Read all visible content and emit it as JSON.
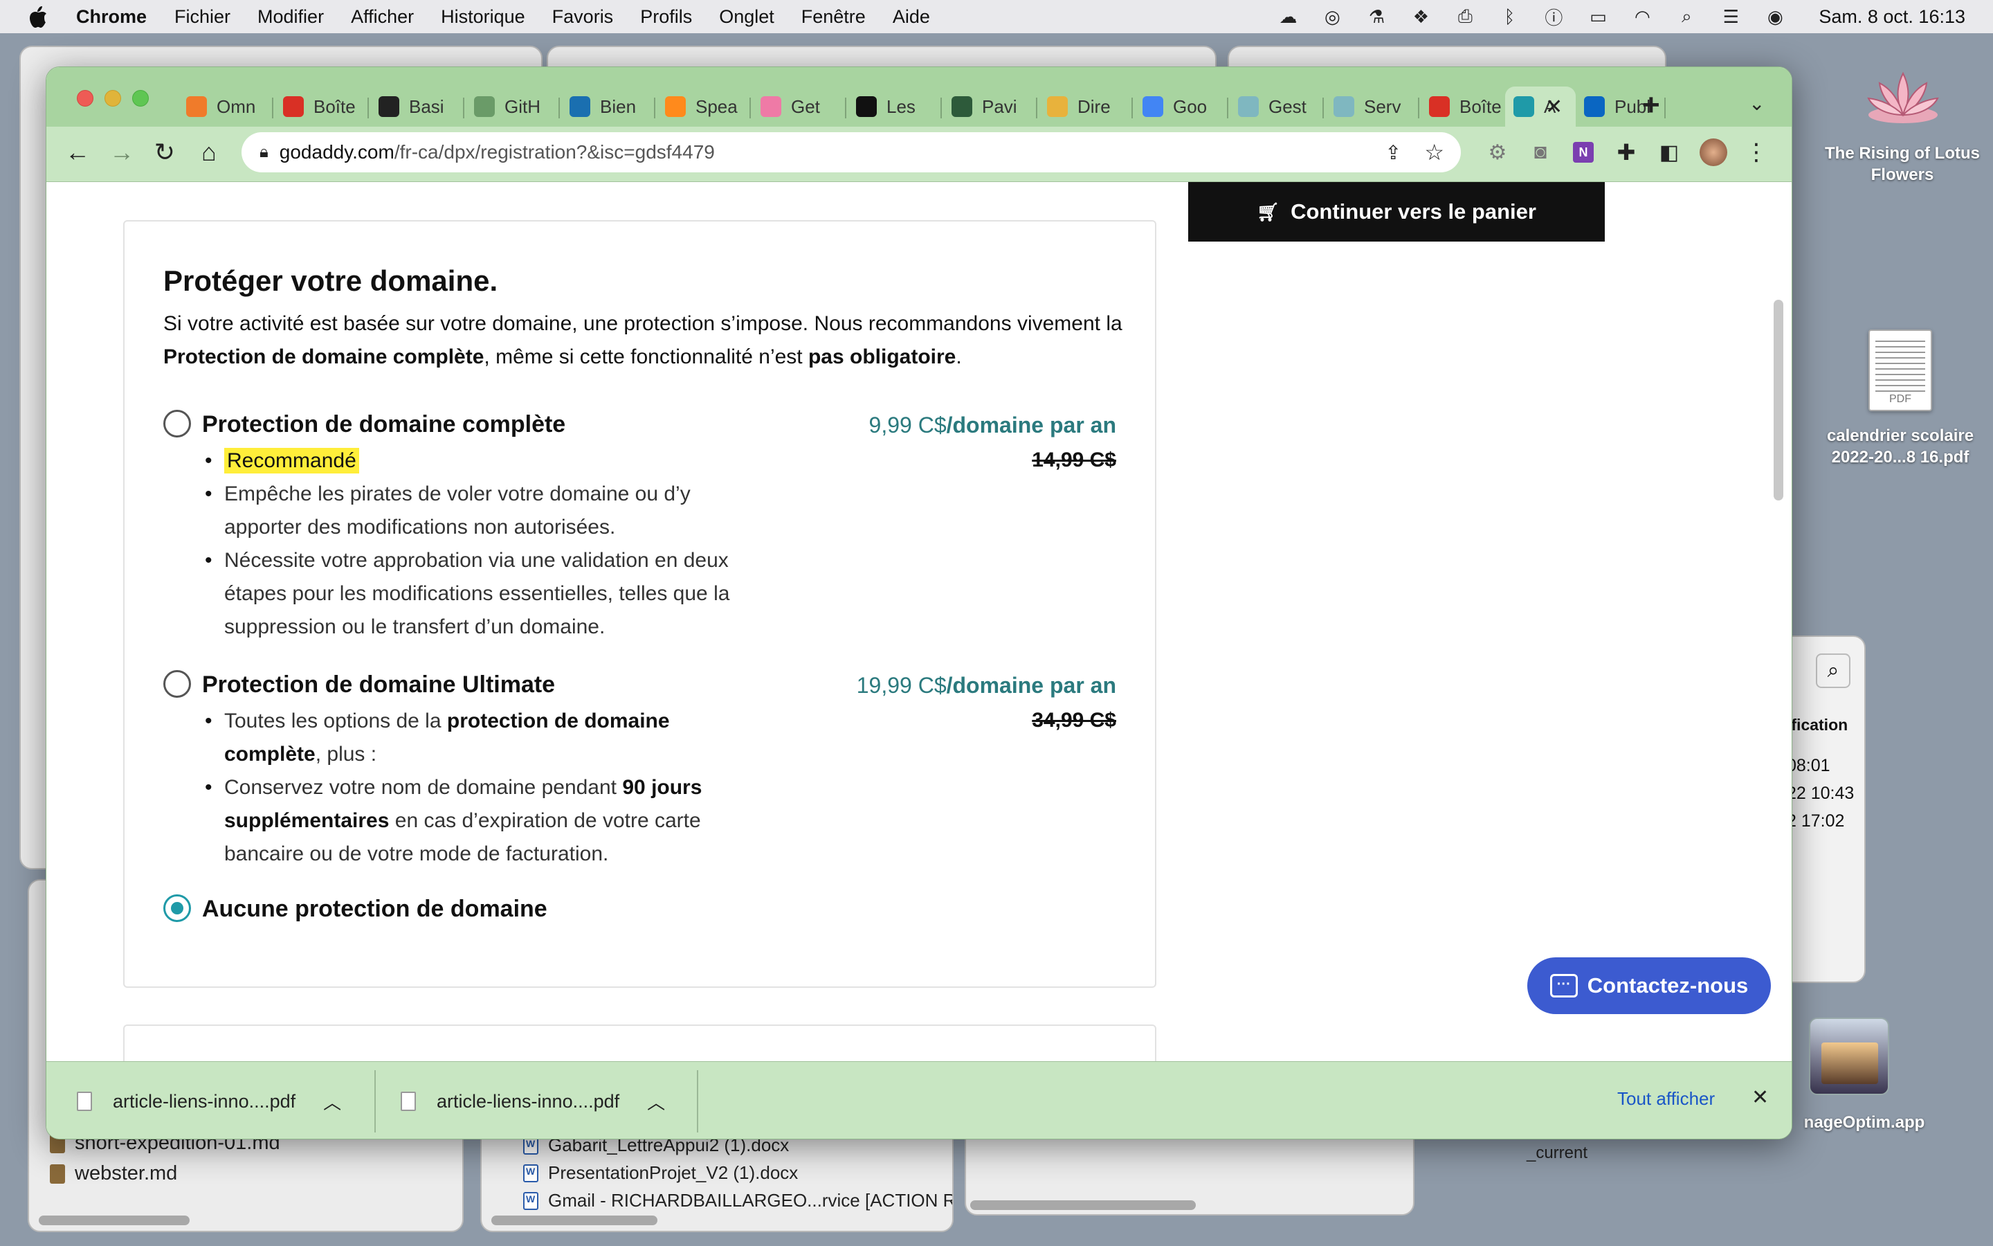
{
  "menubar": {
    "app": "Chrome",
    "items": [
      "Fichier",
      "Modifier",
      "Afficher",
      "Historique",
      "Favoris",
      "Profils",
      "Onglet",
      "Fenêtre",
      "Aide"
    ],
    "clock": "Sam. 8 oct.  16:13"
  },
  "desktop": {
    "lotus_label": "The Rising of Lotus Flowers",
    "pdf_label": "calendrier scolaire 2022-20...8 16.pdf",
    "pdf_badge": "PDF",
    "imageoptim_label": "nageOptim.app",
    "current_label": "_current"
  },
  "bg_finder": {
    "header": "ification",
    "rows": [
      "08:01",
      "22 10:43",
      "2 17:02"
    ]
  },
  "bg_files_left": [
    "short-expedition-01.md",
    "webster.md"
  ],
  "bg_files_mid": [
    "Gabarit_LettreAppui2 (1).docx",
    "PresentationProjet_V2 (1).docx",
    "Gmail - RICHARDBAILLARGEO...rvice [ACTION R..."
  ],
  "tabs": [
    {
      "label": "Omn",
      "color": "#f07b2a"
    },
    {
      "label": "Boîte",
      "color": "#d93025"
    },
    {
      "label": "Basi",
      "color": "#222222"
    },
    {
      "label": "GitH",
      "color": "#6a9b68"
    },
    {
      "label": "Bien",
      "color": "#1a6fb0"
    },
    {
      "label": "Spea",
      "color": "#ff8a1c"
    },
    {
      "label": "Get",
      "color": "#ef7aa6"
    },
    {
      "label": "Les",
      "color": "#111111"
    },
    {
      "label": "Pavi",
      "color": "#2d5a3a"
    },
    {
      "label": "Dire",
      "color": "#e8b23c"
    },
    {
      "label": "Goo",
      "color": "#4285f4"
    },
    {
      "label": "Gest",
      "color": "#7fb7c0"
    },
    {
      "label": "Serv",
      "color": "#7fb7c0"
    },
    {
      "label": "Boîte",
      "color": "#d93025"
    },
    {
      "label": "A",
      "color": "#1f9aa8"
    },
    {
      "label": "Publ",
      "color": "#0a66c2"
    }
  ],
  "address": {
    "host": "godaddy.com",
    "path": "/fr-ca/dpx/registration?&isc=gdsf4479"
  },
  "page": {
    "cart_button": "Continuer vers le panier",
    "title": "Protéger votre domaine.",
    "intro_1": "Si votre activité est basée sur votre domaine, une protection s’impose. Nous recommandons vivement la ",
    "intro_bold_1": "Protection de domaine complète",
    "intro_2": ", même si cette fonctionnalité n’est ",
    "intro_bold_2": "pas obligatoire",
    "intro_3": ".",
    "options": [
      {
        "title": "Protection de domaine complète",
        "price_main": "9,99 C$",
        "price_unit": "/domaine par an",
        "price_old": "14,99 C$",
        "badge": "Recommandé",
        "bullet_1": "Empêche les pirates de voler votre domaine ou d’y apporter des modifications non autorisées.",
        "bullet_2": "Nécessite votre approbation via une validation en deux étapes pour les modifications essentielles, telles que la suppression ou le transfert d’un domaine.",
        "selected": false
      },
      {
        "title": "Protection de domaine Ultimate",
        "price_main": "19,99 C$",
        "price_unit": "/domaine par an",
        "price_old": "34,99 C$",
        "bullet_1_a": "Toutes les options de la ",
        "bullet_1_b": "protection de domaine complète",
        "bullet_1_c": ", plus :",
        "bullet_2_a": "Conservez votre nom de domaine pendant ",
        "bullet_2_b": "90 jours supplémentaires",
        "bullet_2_c": " en cas d’expiration de votre carte bancaire ou de votre mode de facturation.",
        "selected": false
      },
      {
        "title": "Aucune protection de domaine",
        "selected": true
      }
    ],
    "chat_button": "Contactez-nous"
  },
  "downloads": {
    "items": [
      "article-liens-inno....pdf",
      "article-liens-inno....pdf"
    ],
    "show_all": "Tout afficher"
  }
}
